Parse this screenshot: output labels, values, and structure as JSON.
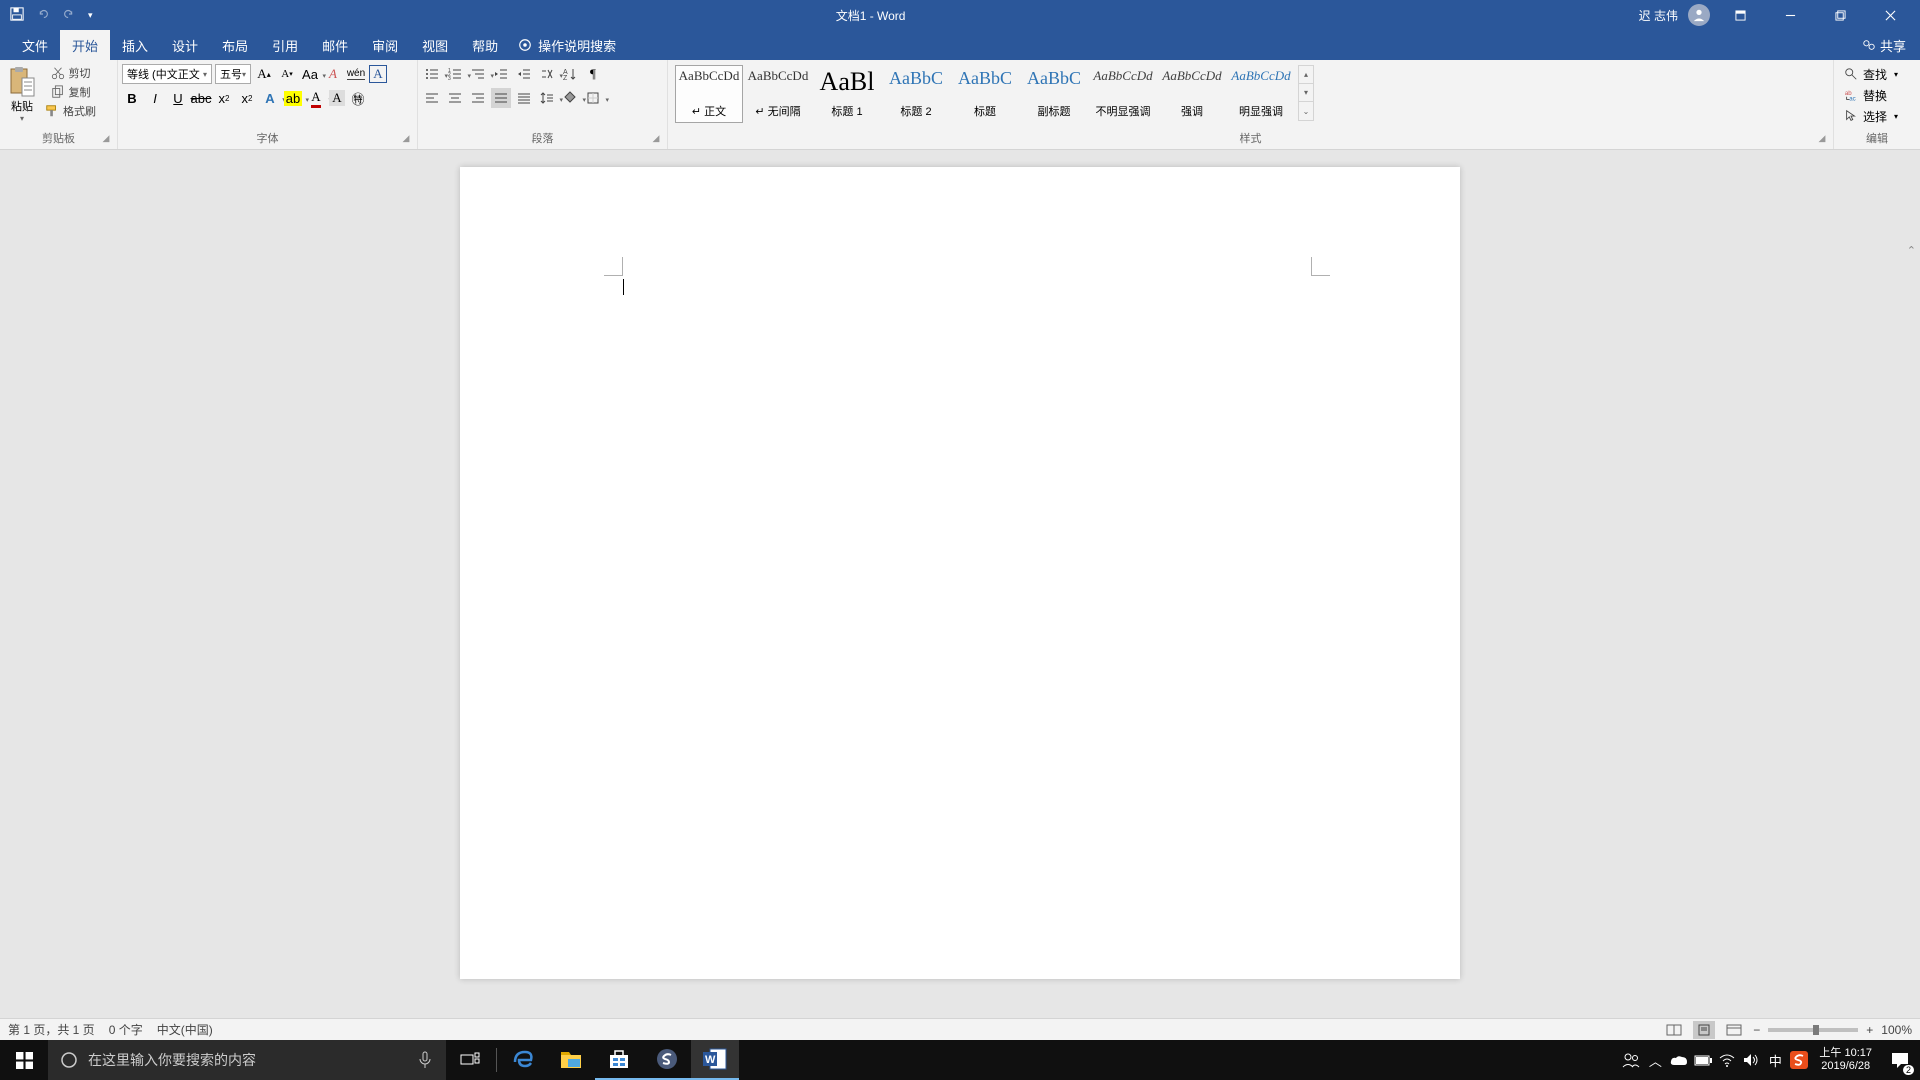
{
  "title": "文档1  -  Word",
  "user": "迟 志伟",
  "qat": {
    "save": "save",
    "undo": "undo",
    "redo": "redo"
  },
  "tabs": [
    "文件",
    "开始",
    "插入",
    "设计",
    "布局",
    "引用",
    "邮件",
    "审阅",
    "视图",
    "帮助"
  ],
  "active_tab": 1,
  "tell_me": "操作说明搜索",
  "share": "共享",
  "clipboard": {
    "paste": "粘贴",
    "cut": "剪切",
    "copy": "复制",
    "painter": "格式刷",
    "label": "剪贴板"
  },
  "font": {
    "name": "等线 (中文正文",
    "size": "五号",
    "label": "字体"
  },
  "paragraph": {
    "label": "段落"
  },
  "styles": {
    "label": "样式",
    "items": [
      {
        "preview": "AaBbCcDd",
        "name": "正文",
        "cls": ""
      },
      {
        "preview": "AaBbCcDd",
        "name": "无间隔",
        "cls": ""
      },
      {
        "preview": "AaBl",
        "name": "标题 1",
        "cls": "big"
      },
      {
        "preview": "AaBbC",
        "name": "标题 2",
        "cls": "med"
      },
      {
        "preview": "AaBbC",
        "name": "标题",
        "cls": "med"
      },
      {
        "preview": "AaBbC",
        "name": "副标题",
        "cls": "med"
      },
      {
        "preview": "AaBbCcDd",
        "name": "不明显强调",
        "cls": "ital"
      },
      {
        "preview": "AaBbCcDd",
        "name": "强调",
        "cls": "ital"
      },
      {
        "preview": "AaBbCcDd",
        "name": "明显强调",
        "cls": "blueital"
      }
    ]
  },
  "editing": {
    "find": "查找",
    "replace": "替换",
    "select": "选择",
    "label": "编辑"
  },
  "statusbar": {
    "page": "第 1 页，共 1 页",
    "words": "0 个字",
    "lang": "中文(中国)",
    "zoom": "100%"
  },
  "taskbar": {
    "search_placeholder": "在这里输入你要搜索的内容"
  },
  "tray": {
    "ime": "中",
    "time": "上午 10:17",
    "date": "2019/6/28",
    "notif_count": "2"
  },
  "colors": {
    "accent": "#2b579a"
  }
}
